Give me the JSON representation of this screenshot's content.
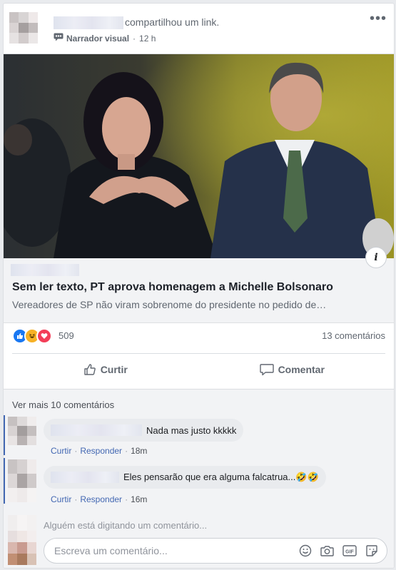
{
  "post": {
    "shared_text": "compartilhou um link.",
    "page_name": "Narrador visual",
    "time": "12 h",
    "more_label": "•••"
  },
  "link": {
    "title": "Sem ler texto, PT aprova homenagem a Michelle Bolsonaro",
    "description": "Vereadores de SP não viram sobrenome do presidente no pedido de…",
    "info_label": "i"
  },
  "reactions": {
    "count": "509",
    "comments_count": "13 comentários",
    "types": [
      "like-icon",
      "haha-icon",
      "love-icon"
    ],
    "colors": {
      "like": "#1877f2",
      "haha": "#f7b125",
      "love": "#f33e58"
    }
  },
  "actions": {
    "like_label": "Curtir",
    "comment_label": "Comentar"
  },
  "comments": {
    "see_more": "Ver mais 10 comentários",
    "items": [
      {
        "text": "Nada mas justo kkkkk",
        "like": "Curtir",
        "reply": "Responder",
        "time": "18m"
      },
      {
        "text": "Eles pensarão que era alguma falcatrua...🤣🤣",
        "like": "Curtir",
        "reply": "Responder",
        "time": "16m"
      }
    ],
    "typing": "Alguém está digitando um comentário...",
    "placeholder": "Escreva um comentário..."
  },
  "colors": {
    "accent": "#4267b2",
    "background": "#e9ebee"
  }
}
